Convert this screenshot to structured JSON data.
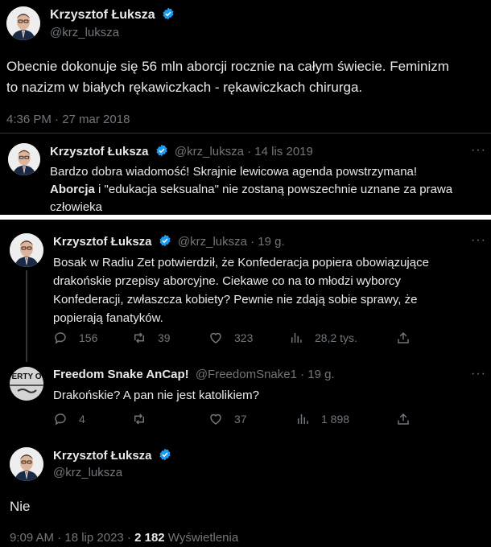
{
  "colors": {
    "background": "#000000",
    "text": "#e7e9ea",
    "muted": "#71767b",
    "verified": "#1d9bf0",
    "divider": "#2f3336"
  },
  "tweet1": {
    "name": "Krzysztof Łuksza",
    "handle": "@krz_luksza",
    "text_line1": "Obecnie dokonuje się 56 mln aborcji rocznie na całym świecie. Feminizm",
    "text_line2": "to nazizm w białych rękawiczkach - rękawiczkach chirurga.",
    "timestamp": "4:36 PM · 27 mar 2018"
  },
  "tweet2": {
    "name": "Krzysztof Łuksza",
    "handle_date": "@krz_luksza · 14 lis 2019",
    "line1": "Bardzo dobra wiadomość! Skrajnie lewicowa agenda powstrzymana!",
    "line2_bold": "Aborcja",
    "line2_rest": " i \"edukacja seksualna\" nie zostaną powszechnie uznane za prawa",
    "line3": "człowieka"
  },
  "tweet3": {
    "name": "Krzysztof Łuksza",
    "handle_date": "@krz_luksza · 19 g.",
    "line1": "Bosak w Radiu Zet potwierdził, że Konfederacja popiera obowiązujące",
    "line2": "drakońskie przepisy aborcyjne. Ciekawe co na to młodzi wyborcy",
    "line3": "Konfederacji, zwłaszcza kobiety? Pewnie nie zdają sobie sprawy, że",
    "line4": "popierają fanatyków.",
    "replies": "156",
    "retweets": "39",
    "likes": "323",
    "views": "28,2 tys."
  },
  "tweet4": {
    "name": "Freedom Snake AnCap!",
    "handle_date": "@FreedomSnake1 · 19 g.",
    "avatar_text": "ERTY O",
    "text": "Drakońskie? A pan nie jest katolikiem?",
    "replies": "4",
    "retweets": "",
    "likes": "37",
    "views": "1 898"
  },
  "tweet5": {
    "name": "Krzysztof Łuksza",
    "handle": "@krz_luksza",
    "text": "Nie",
    "timestamp": "9:09 AM · 18 lip 2023 · ",
    "views_count": "2 182",
    "views_label": " Wyświetlenia"
  },
  "icons": [
    "verified-icon",
    "more-icon",
    "reply-icon",
    "retweet-icon",
    "like-icon",
    "views-icon",
    "share-icon"
  ]
}
